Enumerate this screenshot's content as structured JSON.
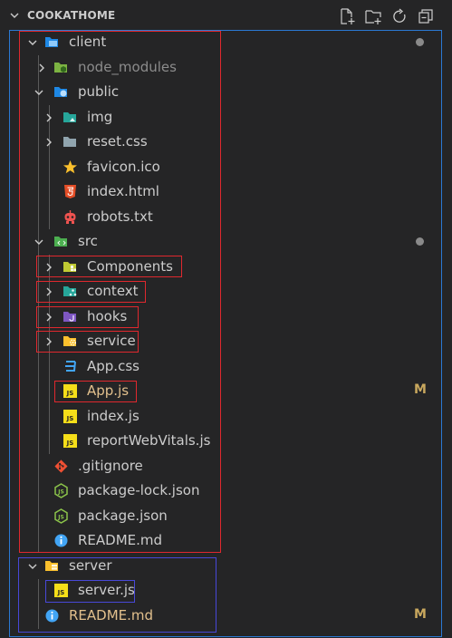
{
  "explorer": {
    "title": "COOKATHOME",
    "toolbar": [
      {
        "name": "new-file-icon"
      },
      {
        "name": "new-folder-icon"
      },
      {
        "name": "refresh-icon"
      },
      {
        "name": "collapse-all-icon"
      }
    ]
  },
  "colors": {
    "background": "#252526",
    "focus_border": "#2b79d3",
    "highlight_red": "#e0282e",
    "highlight_blue": "#4848d8",
    "modified": "#e2c08d",
    "js_icon": "#f5de19",
    "css_icon": "#42a5f5",
    "html_icon": "#e44d26",
    "git_icon": "#f05033",
    "npm_icon": "#8bc34a"
  },
  "tree": [
    {
      "label": "client",
      "icon": "folder-client-open-icon",
      "expanded": true,
      "status_dot": true
    },
    {
      "label": "node_modules",
      "icon": "folder-node-icon",
      "expanded": false,
      "dim": true
    },
    {
      "label": "public",
      "icon": "folder-public-open-icon",
      "expanded": true
    },
    {
      "label": "img",
      "icon": "folder-images-icon",
      "expanded": false
    },
    {
      "label": "reset.css",
      "icon": "folder-icon",
      "expanded": false
    },
    {
      "label": "favicon.ico",
      "icon": "star-icon"
    },
    {
      "label": "index.html",
      "icon": "html5-icon"
    },
    {
      "label": "robots.txt",
      "icon": "robot-icon"
    },
    {
      "label": "src",
      "icon": "folder-src-open-icon",
      "expanded": true,
      "status_dot": true
    },
    {
      "label": "Components",
      "icon": "folder-components-icon",
      "expanded": false
    },
    {
      "label": "context",
      "icon": "folder-context-icon",
      "expanded": false
    },
    {
      "label": "hooks",
      "icon": "folder-hooks-icon",
      "expanded": false
    },
    {
      "label": "service",
      "icon": "folder-service-icon",
      "expanded": false
    },
    {
      "label": "App.css",
      "icon": "css-icon"
    },
    {
      "label": "App.js",
      "icon": "js-icon",
      "status": "M",
      "modified": true
    },
    {
      "label": "index.js",
      "icon": "js-icon"
    },
    {
      "label": "reportWebVitals.js",
      "icon": "js-icon"
    },
    {
      "label": ".gitignore",
      "icon": "git-icon"
    },
    {
      "label": "package-lock.json",
      "icon": "npm-icon"
    },
    {
      "label": "package.json",
      "icon": "npm-icon"
    },
    {
      "label": "README.md",
      "icon": "info-icon"
    },
    {
      "label": "server",
      "icon": "folder-server-open-icon",
      "expanded": true
    },
    {
      "label": "server.js",
      "icon": "js-icon"
    },
    {
      "label": "README.md",
      "icon": "info-icon",
      "status": "M",
      "modified": true
    }
  ]
}
